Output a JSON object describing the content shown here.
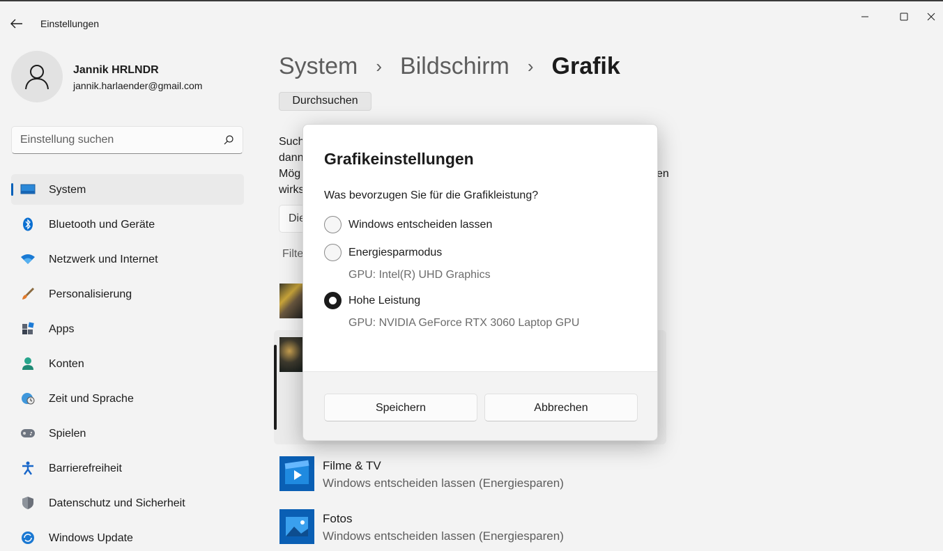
{
  "window": {
    "title": "Einstellungen"
  },
  "user": {
    "name": "Jannik HRLNDR",
    "email": "jannik.harlaender@gmail.com"
  },
  "search": {
    "placeholder": "Einstellung suchen"
  },
  "sidebar": {
    "items": [
      {
        "label": "System",
        "icon": "system-icon",
        "active": true
      },
      {
        "label": "Bluetooth und Geräte",
        "icon": "bluetooth-icon"
      },
      {
        "label": "Netzwerk und Internet",
        "icon": "wifi-icon"
      },
      {
        "label": "Personalisierung",
        "icon": "brush-icon"
      },
      {
        "label": "Apps",
        "icon": "apps-icon"
      },
      {
        "label": "Konten",
        "icon": "person-icon"
      },
      {
        "label": "Zeit und Sprache",
        "icon": "globe-clock-icon"
      },
      {
        "label": "Spielen",
        "icon": "gamepad-icon"
      },
      {
        "label": "Barrierefreiheit",
        "icon": "accessibility-icon"
      },
      {
        "label": "Datenschutz und Sicherheit",
        "icon": "shield-icon"
      },
      {
        "label": "Windows Update",
        "icon": "update-icon"
      }
    ]
  },
  "breadcrumb": {
    "items": [
      "System",
      "Bildschirm"
    ],
    "current": "Grafik"
  },
  "main": {
    "browse_label": "Durchsuchen",
    "partial_lines": [
      "Such",
      "dann",
      "Mög",
      "wirks"
    ],
    "partial_right": "en",
    "partial_dropdown": "Die",
    "partial_filter": "Filte",
    "apps": [
      {
        "name": "Filme & TV",
        "setting": "Windows entscheiden lassen (Energiesparen)",
        "icon": "movies-tv-icon"
      },
      {
        "name": "Fotos",
        "setting": "Windows entscheiden lassen (Energiesparen)",
        "icon": "photos-icon"
      }
    ]
  },
  "dialog": {
    "title": "Grafikeinstellungen",
    "question": "Was bevorzugen Sie für die Grafikleistung?",
    "options": [
      {
        "label": "Windows entscheiden lassen",
        "sub": "",
        "checked": false
      },
      {
        "label": "Energiesparmodus",
        "sub": "GPU: Intel(R) UHD Graphics",
        "checked": false
      },
      {
        "label": "Hohe Leistung",
        "sub": "GPU: NVIDIA GeForce RTX 3060 Laptop GPU",
        "checked": true
      }
    ],
    "save_label": "Speichern",
    "cancel_label": "Abbrechen"
  },
  "colors": {
    "accent": "#005fb8",
    "background": "#f3f3f3"
  }
}
